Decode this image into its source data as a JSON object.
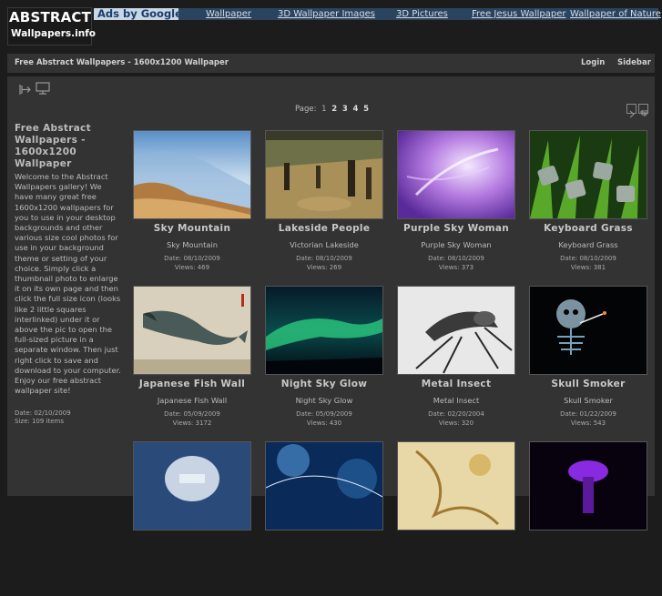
{
  "header": {
    "logo_line1": "ABSTRACT",
    "logo_line2": "Wallpapers.info",
    "ads_label": "Ads by Google",
    "links": [
      "Wallpaper",
      "3D Wallpaper Images",
      "3D Pictures",
      "Free Jesus Wallpaper",
      "Wallpaper of Nature"
    ]
  },
  "titlebar": {
    "title": "Free Abstract Wallpapers - 1600x1200 Wallpaper",
    "login": "Login",
    "sidebar": "Sidebar"
  },
  "pagination": {
    "label": "Page:",
    "pages": [
      "1",
      "2",
      "3",
      "4",
      "5"
    ]
  },
  "sidebar": {
    "title": "Free Abstract Wallpapers - 1600x1200 Wallpaper",
    "description": "Welcome to the Abstract Wallpapers gallery! We have many great free 1600x1200 wallpapers for you to use in your desktop backgrounds and other various size cool photos for use in your background theme or setting of your choice. Simply click a thumbnail photo to enlarge it on its own page and then click the full size icon (looks like 2 little squares interlinked) under it or above the pic to open the full-sized picture in a separate window. Then just right click to save and download to your computer. Enjoy our free abstract wallpaper site!",
    "date": "Date: 02/10/2009",
    "size": "Size: 109 items"
  },
  "items": [
    {
      "title": "Sky Mountain",
      "subtitle": "Sky Mountain",
      "date": "Date: 08/10/2009",
      "views": "Views: 469"
    },
    {
      "title": "Lakeside People",
      "subtitle": "Victorian Lakeside",
      "date": "Date: 08/10/2009",
      "views": "Views: 269"
    },
    {
      "title": "Purple Sky Woman",
      "subtitle": "Purple Sky Woman",
      "date": "Date: 08/10/2009",
      "views": "Views: 373"
    },
    {
      "title": "Keyboard Grass",
      "subtitle": "Keyboard Grass",
      "date": "Date: 08/10/2009",
      "views": "Views: 381"
    },
    {
      "title": "Japanese Fish Wall",
      "subtitle": "Japanese Fish Wall",
      "date": "Date: 05/09/2009",
      "views": "Views: 3172"
    },
    {
      "title": "Night Sky Glow",
      "subtitle": "Night Sky Glow",
      "date": "Date: 05/09/2009",
      "views": "Views: 430"
    },
    {
      "title": "Metal Insect",
      "subtitle": "Metal Insect",
      "date": "Date: 02/20/2004",
      "views": "Views: 320"
    },
    {
      "title": "Skull Smoker",
      "subtitle": "Skull Smoker",
      "date": "Date: 01/22/2009",
      "views": "Views: 543"
    }
  ],
  "icons": {
    "tool_left": "exit-icon",
    "tool_right": "monitor-icon",
    "nav_prev": "prev-page-icon",
    "nav_next": "next-page-icon"
  }
}
